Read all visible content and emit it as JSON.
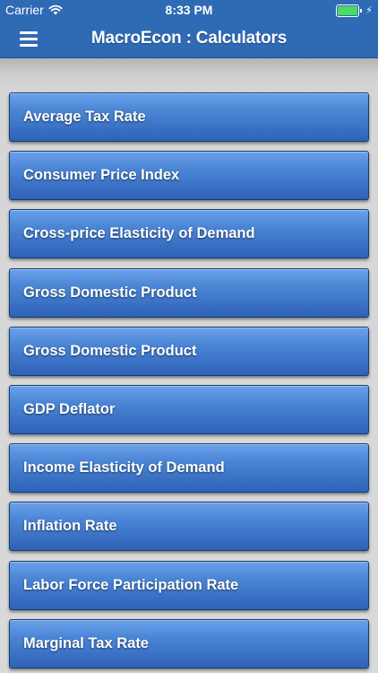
{
  "status_bar": {
    "carrier": "Carrier",
    "time": "8:33 PM",
    "battery_level": 1.0,
    "battery_color": "#4cd964",
    "wifi_icon": "wifi-icon",
    "charging_icon": "charging-bolt-icon"
  },
  "nav": {
    "menu_icon": "hamburger-menu-icon",
    "title": "MacroEcon : Calculators"
  },
  "theme": {
    "bar_color": "#2f6ab5",
    "button_top": "#6aa2ea",
    "button_bottom": "#2e62b7",
    "background": "#d9d9d9"
  },
  "calculators": [
    {
      "label": "Average Tax Rate"
    },
    {
      "label": "Consumer Price Index"
    },
    {
      "label": "Cross-price Elasticity of Demand"
    },
    {
      "label": "Gross Domestic Product"
    },
    {
      "label": "Gross Domestic Product"
    },
    {
      "label": "GDP Deflator"
    },
    {
      "label": "Income Elasticity of Demand"
    },
    {
      "label": "Inflation Rate"
    },
    {
      "label": "Labor Force Participation Rate"
    },
    {
      "label": "Marginal Tax Rate"
    }
  ]
}
